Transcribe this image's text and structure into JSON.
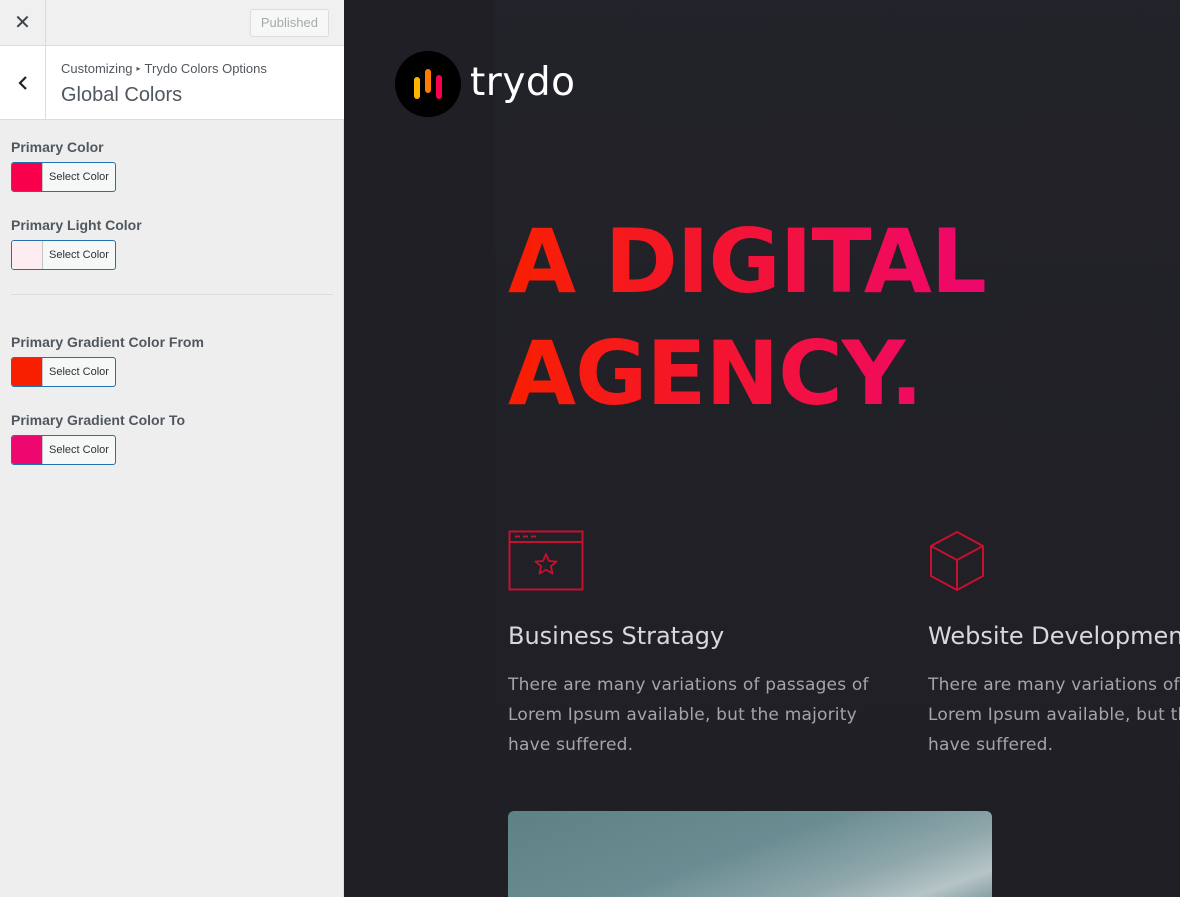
{
  "customizer": {
    "close_icon": "close-icon",
    "publish_label": "Published",
    "breadcrumb": {
      "root": "Customizing",
      "parent": "Trydo Colors Options"
    },
    "section_title": "Global Colors",
    "controls": [
      {
        "label": "Primary Color",
        "button_label": "Select Color",
        "value": "#f9004d"
      },
      {
        "label": "Primary Light Color",
        "button_label": "Select Color",
        "value": "#fdedf1"
      },
      {
        "label": "Primary Gradient Color From",
        "button_label": "Select Color",
        "value": "#f81f01"
      },
      {
        "label": "Primary Gradient Color To",
        "button_label": "Select Color",
        "value": "#ee076e"
      }
    ]
  },
  "preview": {
    "logo_text": "trydo",
    "hero_line1": "A DIGITAL",
    "hero_line2": "AGENCY.",
    "services": [
      {
        "icon": "browser-star-icon",
        "title": "Business Stratagy",
        "description": "There are many variations of passages of Lorem Ipsum available, but the majority have suffered."
      },
      {
        "icon": "cube-icon",
        "title": "Website Development",
        "description": "There are many variations of passages of Lorem Ipsum available, but the majority have suffered."
      }
    ]
  },
  "colors": {
    "accent_red": "#f9004d",
    "icon_stroke": "#c6102e",
    "preview_bg": "#1f1f25"
  }
}
